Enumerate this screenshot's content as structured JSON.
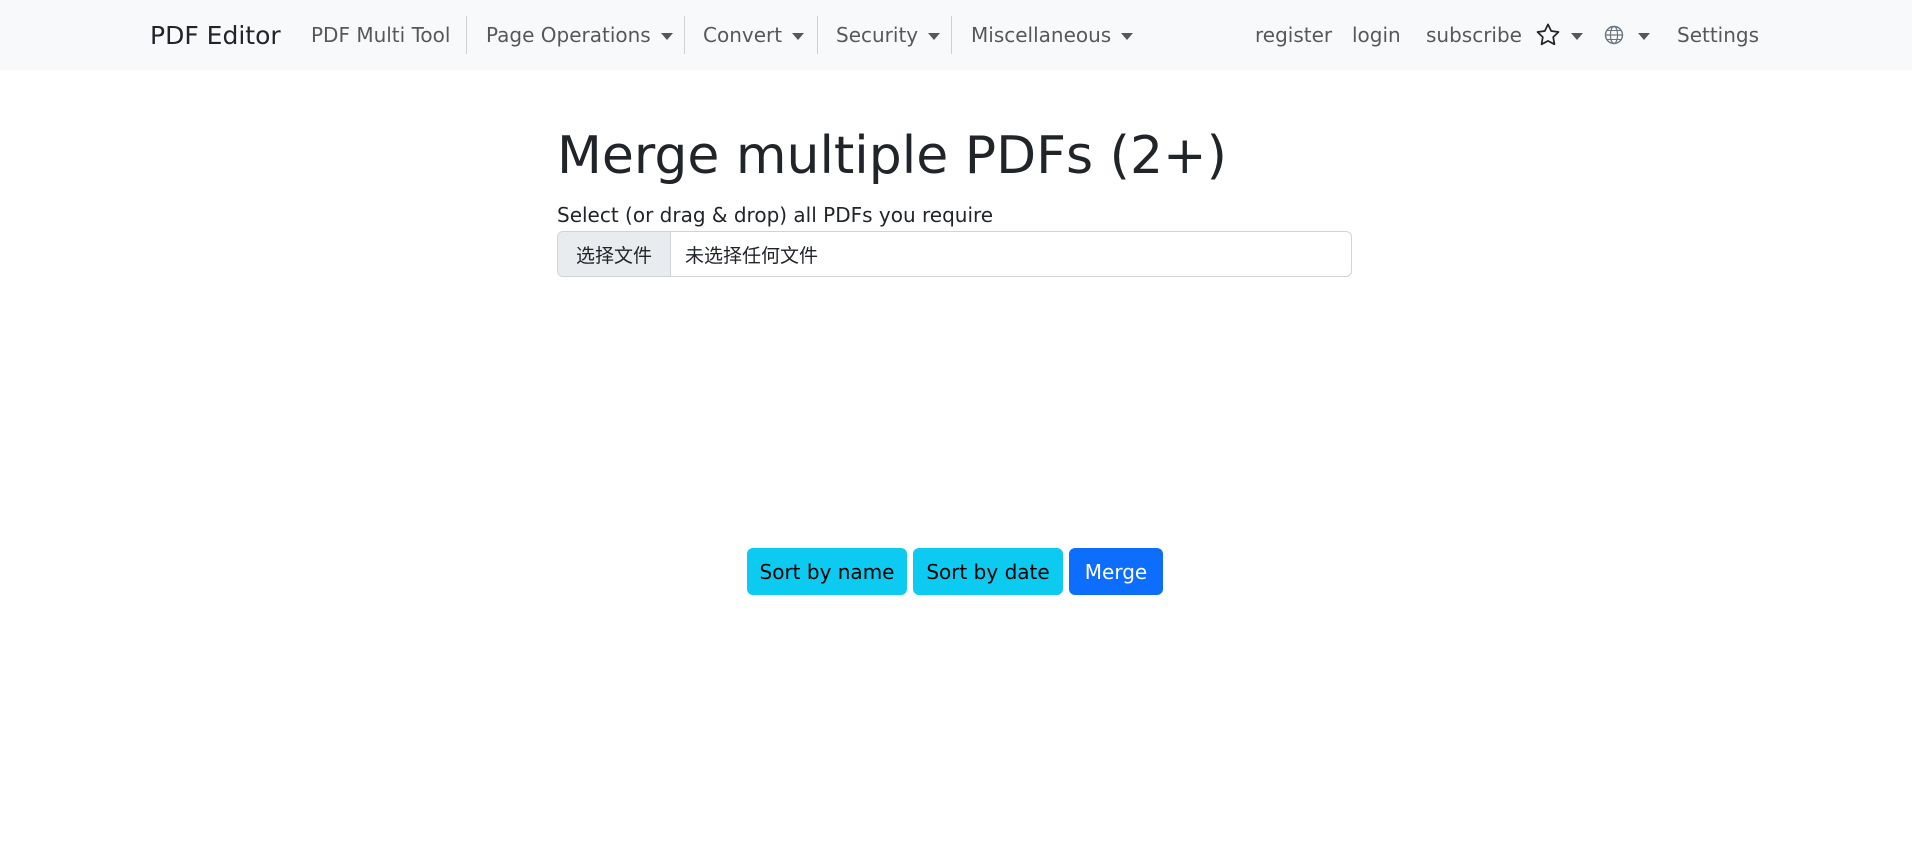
{
  "navbar": {
    "brand": "PDF Editor",
    "items": [
      {
        "label": "PDF Multi Tool",
        "dropdown": false
      },
      {
        "label": "Page Operations",
        "dropdown": true
      },
      {
        "label": "Convert",
        "dropdown": true
      },
      {
        "label": "Security",
        "dropdown": true
      },
      {
        "label": "Miscellaneous",
        "dropdown": true
      }
    ],
    "right": {
      "register": "register",
      "login": "login",
      "subscribe": "subscribe",
      "favorites_icon": "star-icon",
      "language_icon": "globe-icon",
      "settings": "Settings"
    }
  },
  "main": {
    "title": "Merge multiple PDFs (2+)",
    "file_label": "Select (or drag & drop) all PDFs you require",
    "file_input": {
      "button_label": "选择文件",
      "status_text": "未选择任何文件"
    },
    "buttons": {
      "sort_by_name": "Sort by name",
      "sort_by_date": "Sort by date",
      "merge": "Merge"
    }
  },
  "colors": {
    "navbar_bg": "#f8f9fa",
    "info": "#0dcaf0",
    "primary": "#0d6efd"
  }
}
